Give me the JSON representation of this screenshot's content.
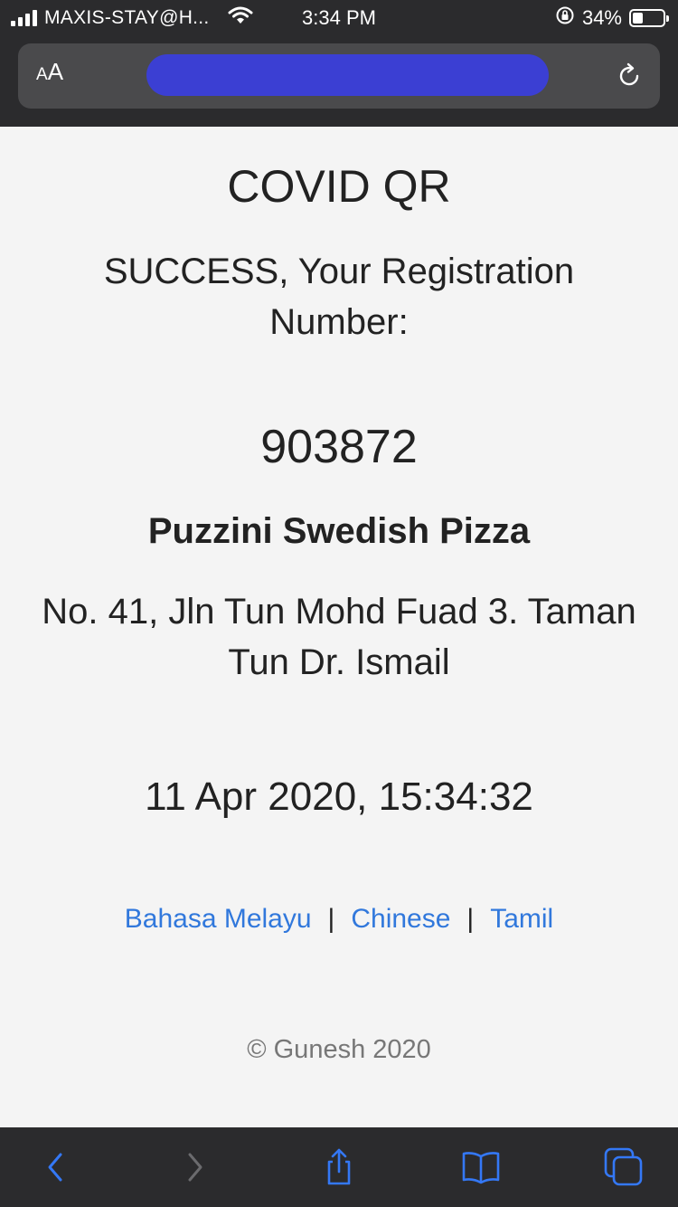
{
  "status_bar": {
    "carrier": "MAXIS-STAY@H...",
    "time": "3:34 PM",
    "battery_percent": "34%",
    "battery_level": 0.34,
    "icons": [
      "signal-icon",
      "wifi-icon",
      "orientation-lock-icon",
      "battery-icon"
    ]
  },
  "browser": {
    "text_size_label": "AA",
    "icons": [
      "reload-icon"
    ]
  },
  "page": {
    "title": "COVID QR",
    "success_message": "SUCCESS, Your Registration Number:",
    "registration_number": "903872",
    "place_name": "Puzzini Swedish Pizza",
    "address": "No. 41, Jln Tun Mohd Fuad 3. Taman Tun Dr. Ismail",
    "datetime": "11 Apr 2020, 15:34:32",
    "languages": [
      "Bahasa Melayu",
      "Chinese",
      "Tamil"
    ],
    "separator": "|",
    "footer": "© Gunesh 2020"
  },
  "toolbar": {
    "icons": [
      "back-icon",
      "forward-icon",
      "share-icon",
      "bookmarks-icon",
      "tabs-icon"
    ]
  },
  "colors": {
    "link": "#3178dc",
    "chrome": "#2b2b2d",
    "url_field": "#4a4a4c",
    "redaction": "#3b3fd3",
    "background": "#f4f4f4"
  }
}
